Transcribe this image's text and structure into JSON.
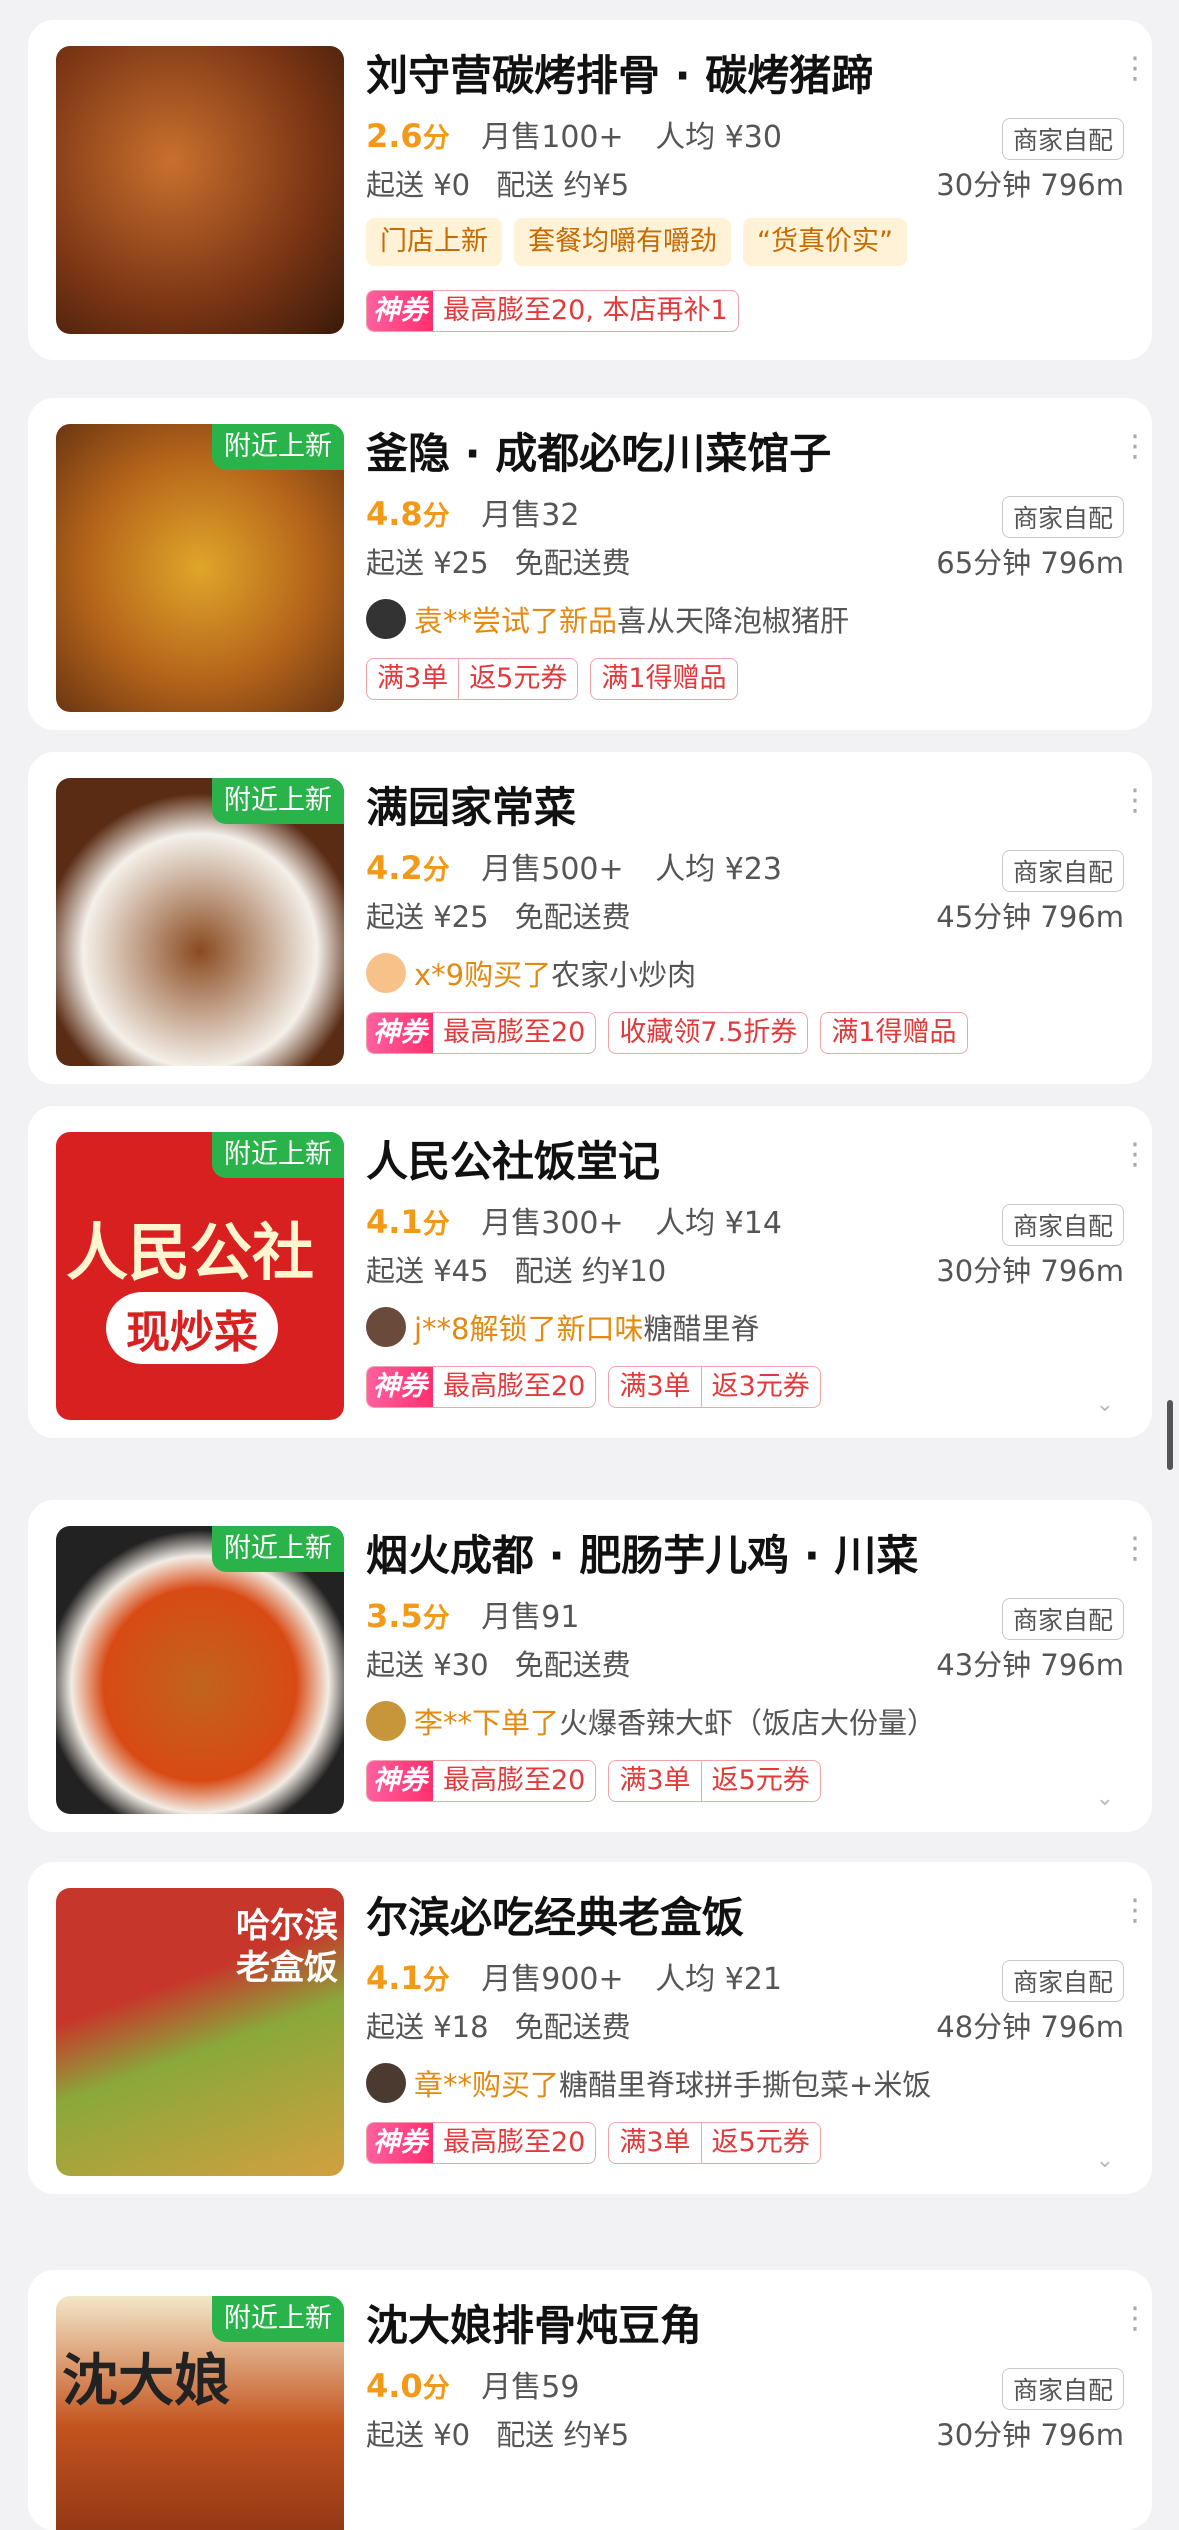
{
  "colors": {
    "accent_green": "#2ab34a",
    "rating_orange": "#f29a18",
    "coupon_red": "#e2393b",
    "highlight_orange": "#e58a10"
  },
  "stores": [
    {
      "title": "刘守营碳烤排骨 · 碳烤猪蹄",
      "rating": "2.6",
      "rating_unit": "分",
      "monthly": "月售100+",
      "avg": "人均 ¥30",
      "tag": "商家自配",
      "min_order": "起送 ¥0",
      "delivery": "配送 约¥5",
      "eta": "30分钟 796m",
      "features": [
        "门店上新",
        "套餐均嚼有嚼劲",
        "“货真价实”"
      ],
      "coupon_prefix": "神券",
      "coupon": "最高膨至20, 本店再补1"
    },
    {
      "title": "釜隐 · 成都必吃川菜馆子",
      "badge": "附近上新",
      "rating": "4.8",
      "rating_unit": "分",
      "monthly": "月售32",
      "avg": "",
      "tag": "商家自配",
      "min_order": "起送 ¥25",
      "delivery": "免配送费",
      "eta": "65分钟 796m",
      "activity_hl": "袁**尝试了新品",
      "activity_text": "喜从天降泡椒猪肝",
      "tags": [
        [
          "满3单",
          "返5元券"
        ],
        [
          "满1得赠品"
        ]
      ]
    },
    {
      "title": "满园家常菜",
      "badge": "附近上新",
      "rating": "4.2",
      "rating_unit": "分",
      "monthly": "月售500+",
      "avg": "人均 ¥23",
      "tag": "商家自配",
      "min_order": "起送 ¥25",
      "delivery": "免配送费",
      "eta": "45分钟 796m",
      "activity_hl": "x*9购买了",
      "activity_text": "农家小炒肉",
      "coupon_prefix": "神券",
      "coupon": "最高膨至20",
      "tags": [
        [
          "收藏领7.5折券"
        ],
        [
          "满1得赠品"
        ]
      ]
    },
    {
      "title": "人民公社饭堂记",
      "badge": "附近上新",
      "rating": "4.1",
      "rating_unit": "分",
      "monthly": "月售300+",
      "avg": "人均 ¥14",
      "tag": "商家自配",
      "min_order": "起送 ¥45",
      "delivery": "配送 约¥10",
      "eta": "30分钟 796m",
      "activity_hl": "j**8解锁了新口味",
      "activity_text": "糖醋里脊",
      "coupon_prefix": "神券",
      "coupon": "最高膨至20",
      "tags": [
        [
          "满3单",
          "返3元券"
        ]
      ],
      "thumb_text": "人民公社",
      "thumb_text2": "现炒菜"
    },
    {
      "title": "烟火成都 · 肥肠芋儿鸡 · 川菜",
      "badge": "附近上新",
      "rating": "3.5",
      "rating_unit": "分",
      "monthly": "月售91",
      "avg": "",
      "tag": "商家自配",
      "min_order": "起送 ¥30",
      "delivery": "免配送费",
      "eta": "43分钟 796m",
      "activity_hl": "李**下单了",
      "activity_text": "火爆香辣大虾（饭店大份量）",
      "coupon_prefix": "神券",
      "coupon": "最高膨至20",
      "tags": [
        [
          "满3单",
          "返5元券"
        ]
      ]
    },
    {
      "title": "尔滨必吃经典老盒饭",
      "rating": "4.1",
      "rating_unit": "分",
      "monthly": "月售900+",
      "avg": "人均 ¥21",
      "tag": "商家自配",
      "min_order": "起送 ¥18",
      "delivery": "免配送费",
      "eta": "48分钟 796m",
      "activity_hl": "章**购买了",
      "activity_text": "糖醋里脊球拼手撕包菜+米饭",
      "coupon_prefix": "神券",
      "coupon": "最高膨至20",
      "tags": [
        [
          "满3单",
          "返5元券"
        ]
      ],
      "thumb_text": "哈尔滨",
      "thumb_text2": "老盒饭"
    },
    {
      "title": "沈大娘排骨炖豆角",
      "badge": "附近上新",
      "rating": "4.0",
      "rating_unit": "分",
      "monthly": "月售59",
      "avg": "",
      "tag": "商家自配",
      "min_order": "起送 ¥0",
      "delivery": "配送 约¥5",
      "eta": "30分钟 796m",
      "thumb_text": "沈大娘"
    }
  ]
}
